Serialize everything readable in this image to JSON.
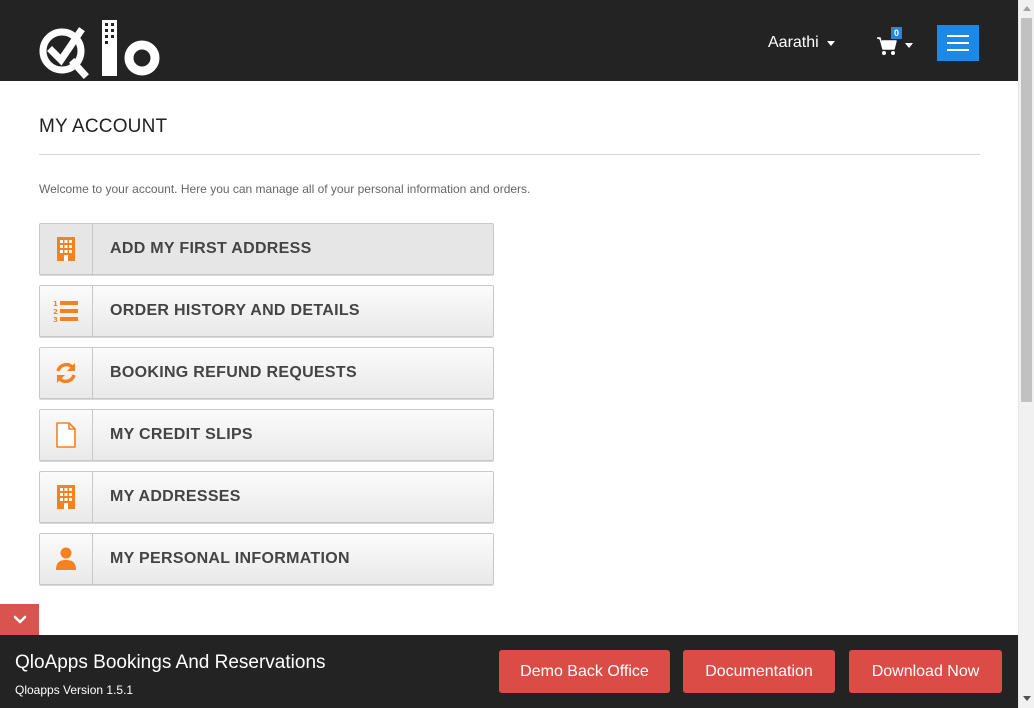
{
  "header": {
    "user_name": "Aarathi",
    "cart_count": "0"
  },
  "colors": {
    "accent_orange": "#f58220",
    "accent_blue": "#1e88e5",
    "demo_red": "#dc4c46",
    "dark_bg": "#232323"
  },
  "main": {
    "title": "MY ACCOUNT",
    "welcome": "Welcome to your account. Here you can manage all of your personal information and orders.",
    "items": [
      {
        "label": "ADD MY FIRST ADDRESS",
        "icon": "building-icon"
      },
      {
        "label": "ORDER HISTORY AND DETAILS",
        "icon": "ordered-list-icon"
      },
      {
        "label": "BOOKING REFUND REQUESTS",
        "icon": "refresh-icon"
      },
      {
        "label": "MY CREDIT SLIPS",
        "icon": "file-icon"
      },
      {
        "label": "MY ADDRESSES",
        "icon": "building-icon"
      },
      {
        "label": "MY PERSONAL INFORMATION",
        "icon": "user-icon"
      }
    ]
  },
  "demo_bar": {
    "title": "QloApps Bookings And Reservations",
    "version": "Qloapps Version 1.5.1",
    "back_office_label": "Demo Back Office",
    "docs_label": "Documentation",
    "download_label": "Download Now"
  }
}
